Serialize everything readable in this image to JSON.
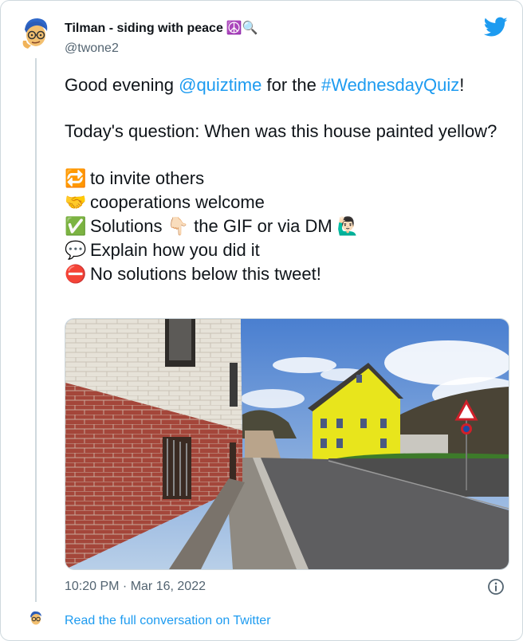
{
  "author": {
    "name": "Tilman - siding with peace",
    "name_emoji": "☮️🔍",
    "handle": "@twone2"
  },
  "tweet": {
    "intro_prefix": "Good evening ",
    "mention": "@quiztime",
    "intro_mid": " for the ",
    "hashtag": "#WednesdayQuiz",
    "intro_suffix": "!",
    "question": "Today's question: When was this house painted yellow?",
    "lines": [
      {
        "icon": "repeat-icon",
        "emoji": "🔁",
        "text": "to invite others"
      },
      {
        "icon": "handshake-icon",
        "emoji": "🤝",
        "text": "cooperations welcome"
      },
      {
        "icon": "check-icon",
        "emoji": "✅",
        "text": "Solutions 👇🏻 the GIF or via DM 🙋🏻‍♂️"
      },
      {
        "icon": "speech-bubble-icon",
        "emoji": "💬",
        "text": "Explain how you did it"
      },
      {
        "icon": "no-entry-icon",
        "emoji": "⛔",
        "text": "No solutions below this tweet!"
      }
    ]
  },
  "timestamp": "10:20 PM · Mar 16, 2022",
  "read_more": "Read the full conversation on Twitter",
  "colors": {
    "link": "#1d9bf0",
    "muted": "#536471",
    "border": "#cfd9de",
    "house": "#e8e51c"
  }
}
